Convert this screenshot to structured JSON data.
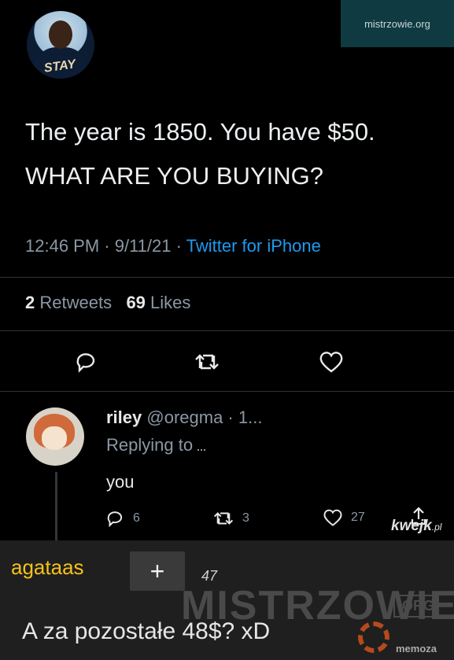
{
  "site_badge": "mistrzowie.org",
  "tweet": {
    "text_line1": "The year is 1850. You have $50.",
    "text_line2": "WHAT ARE YOU BUYING?",
    "time": "12:46 PM · 9/11/21 · ",
    "source": "Twitter for iPhone",
    "retweets_count": "2",
    "retweets_label": "Retweets",
    "likes_count": "69",
    "likes_label": "Likes"
  },
  "reply": {
    "name": "riley",
    "handle": "@oregma · 1...",
    "replying_to": "Replying to",
    "text": "you",
    "replies": "6",
    "retweets": "3",
    "likes": "27"
  },
  "kwejk": {
    "name": "kwejk",
    "tld": ".pl"
  },
  "comment": {
    "username": "agataas",
    "plus_label": "+",
    "votes": "47",
    "watermark": "MISTRZOWIE",
    "watermark_org": ".ORG",
    "memoza": "memoza",
    "text": "A za pozostałe 48$? xD"
  },
  "colors": {
    "link": "#1d9bf0",
    "username": "#f5c21b",
    "background": "#000000"
  }
}
